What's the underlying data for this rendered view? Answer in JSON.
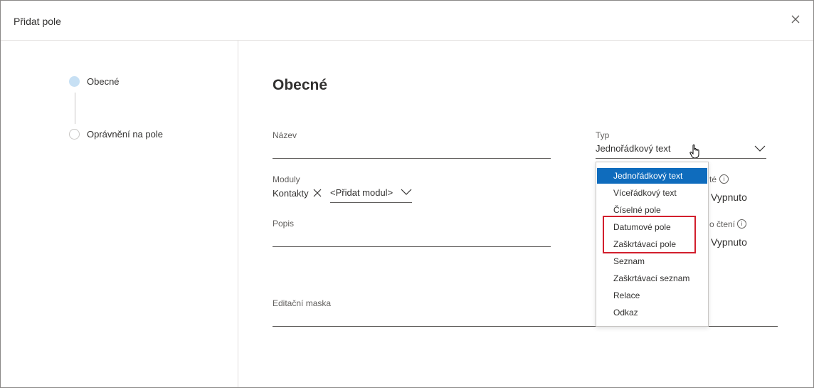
{
  "dialog": {
    "title": "Přidat pole",
    "close_icon": "close-icon"
  },
  "steps": [
    {
      "label": "Obecné",
      "state": "active"
    },
    {
      "label": "Oprávnění na pole",
      "state": "inactive"
    }
  ],
  "form": {
    "section_title": "Obecné",
    "name": {
      "label": "Název",
      "value": ""
    },
    "type": {
      "label": "Typ",
      "value": "Jednořádkový text"
    },
    "modules": {
      "label": "Moduly",
      "chip": "Kontakty",
      "add_placeholder": "<Přidat modul>"
    },
    "description": {
      "label": "Popis",
      "value": ""
    },
    "edit_mask": {
      "label": "Editační maska",
      "value": ""
    },
    "toggle1": {
      "label_fragment": "té",
      "value": "Vypnuto"
    },
    "toggle2": {
      "label_fragment": "o čtení",
      "value": "Vypnuto"
    }
  },
  "type_dropdown": {
    "options": [
      "Jednořádkový text",
      "Víceřádkový text",
      "Číselné pole",
      "Datumové pole",
      "Zaškrtávací pole",
      "Seznam",
      "Zaškrtávací seznam",
      "Relace",
      "Odkaz"
    ],
    "selected": "Jednořádkový text",
    "highlighted": [
      "Datumové pole",
      "Zaškrtávací pole"
    ]
  },
  "colors": {
    "accent": "#0f6cbd",
    "highlight_border": "#d21f2d",
    "step_active": "#c7e0f4"
  }
}
